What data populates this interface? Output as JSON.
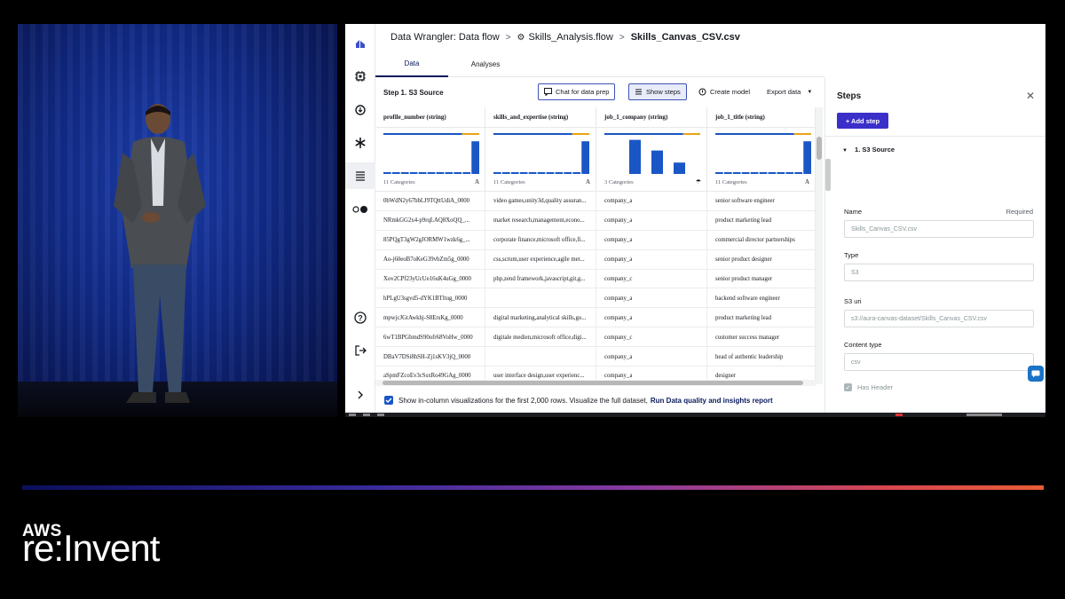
{
  "header": {
    "crumb1": "Data Wrangler: Data flow",
    "crumb2": "Skills_Analysis.flow",
    "crumb3": "Skills_Canvas_CSV.csv"
  },
  "tabs": [
    "Data",
    "Analyses"
  ],
  "toolbar": {
    "step_title": "Step 1. S3 Source",
    "chat_label": "Chat for data prep",
    "show_steps_label": "Show steps",
    "create_model_label": "Create model",
    "export_label": "Export data"
  },
  "columns": [
    "profile_number (string)",
    "skills_and_expertise (string)",
    "job_1_company (string)",
    "job_1_title (string)"
  ],
  "column_viz": [
    {
      "category_label": "11 Categories",
      "type_label": "A",
      "bars": [
        0.05,
        0.05,
        0.05,
        0.05,
        0.05,
        0.05,
        0.05,
        0.05,
        0.05,
        0.05,
        0.92
      ]
    },
    {
      "category_label": "11 Categories",
      "type_label": "A",
      "bars": [
        0.05,
        0.05,
        0.05,
        0.05,
        0.05,
        0.05,
        0.05,
        0.05,
        0.05,
        0.05,
        0.92
      ]
    },
    {
      "category_label": "3 Categories",
      "type_label": "☂",
      "bars": [
        0.96,
        0.66,
        0.32
      ]
    },
    {
      "category_label": "11 Categories",
      "type_label": "A",
      "bars": [
        0.05,
        0.05,
        0.05,
        0.05,
        0.05,
        0.05,
        0.05,
        0.05,
        0.05,
        0.05,
        0.92
      ]
    }
  ],
  "rows": [
    [
      "0bWdN2y67bbLJ9TQttUdiA_0000",
      "video games,unity3d,quality assuran...",
      "company_a",
      "senior software engineer"
    ],
    [
      "NRmkGG2x4-p9rqLAQ8XoQQ_...",
      "market research,management,econo...",
      "company_a",
      "product marketing lead"
    ],
    [
      "85PQgT3gW2gJORMW1wzk6g_...",
      "corporate finance,microsoft office,fi...",
      "company_a",
      "commercial director partnerships"
    ],
    [
      "Ao-j60eoB7oKeG39vbZm5g_0000",
      "css,scrum,user experience,agile met...",
      "company_a",
      "senior product designer"
    ],
    [
      "Xov2CPf23yUcUe16uK4uGg_0000",
      "php,zend framework,javascript,git,g...",
      "company_c",
      "senior product manager"
    ],
    [
      "hPLgU3sgvd5-dYK1BTltug_0000",
      "",
      "company_a",
      "backend software engineer"
    ],
    [
      "mpwjcJGtAwkhj-S8ErsKg_0000",
      "digital marketing,analytical skills,go...",
      "company_a",
      "product marketing lead"
    ],
    [
      "6wT1BPGbmdS90ofr68VoHw_0000",
      "digitale medien,microsoft office,digi...",
      "company_c",
      "customer success manager"
    ],
    [
      "DBaV7DSi8hSH-Zj1sKV3jQ_0000",
      "",
      "company_a",
      "head of authentic leadership"
    ],
    [
      "aSpmFZcoEv3cSsxRo49GAg_0000",
      "user interface design,user experienc...",
      "company_a",
      "designer"
    ]
  ],
  "footer": {
    "text": "Show in-column visualizations for the first 2,000 rows. Visualize the full dataset,",
    "link": "Run Data quality and insights report"
  },
  "steps_panel": {
    "title": "Steps",
    "add_step": "+ Add step",
    "section": "1. S3 Source",
    "name_label": "Name",
    "required": "Required",
    "name_value": "Skills_Canvas_CSV.csv",
    "type_label": "Type",
    "type_value": "S3",
    "uri_label": "S3 uri",
    "uri_value": "s3://aura-canvas-dataset/Skills_Canvas_CSV.csv",
    "content_label": "Content type",
    "content_value": "csv",
    "has_header": "Has Header"
  },
  "colors": {
    "accent": "#0a1a5c",
    "button_primary": "#3b2fc9",
    "bar": "#1a56c5",
    "bar_top_orange": "#e8a317"
  },
  "brand": {
    "aws": "AWS",
    "event": "re:Invent"
  }
}
